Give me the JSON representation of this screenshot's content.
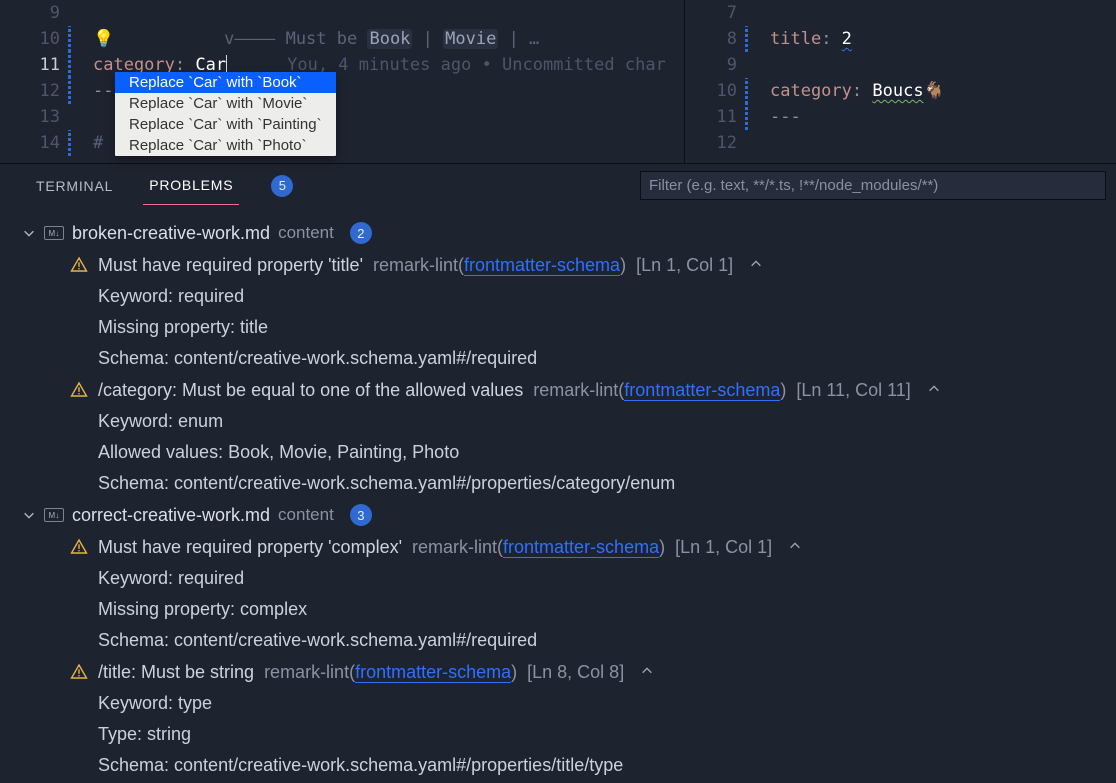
{
  "left_editor": {
    "lines": [
      {
        "num": "9",
        "type": "blank"
      },
      {
        "num": "10",
        "type": "hint",
        "hint_prefix": "v———— Must be ",
        "options": [
          "Book",
          "Movie",
          "…"
        ]
      },
      {
        "num": "11",
        "type": "kv",
        "key": "category",
        "colon": ": ",
        "value": "Car",
        "blame": "You, 4 minutes ago • Uncommitted char"
      },
      {
        "num": "12",
        "type": "dashes",
        "text": "--"
      },
      {
        "num": "13",
        "type": "blank"
      },
      {
        "num": "14",
        "type": "hash",
        "text": "#"
      }
    ]
  },
  "quickfix": [
    "Replace `Car` with `Book`",
    "Replace `Car` with `Movie`",
    "Replace `Car` with `Painting`",
    "Replace `Car` with `Photo`"
  ],
  "right_editor": {
    "lines": [
      {
        "num": "7",
        "type": "blank"
      },
      {
        "num": "8",
        "type": "kv",
        "key": "title",
        "colon": ": ",
        "value": "2",
        "squig": "blue"
      },
      {
        "num": "9",
        "type": "blank"
      },
      {
        "num": "10",
        "type": "kv",
        "key": "category",
        "colon": ": ",
        "value": "Boucs",
        "squig": "green",
        "emoji": "🐐"
      },
      {
        "num": "11",
        "type": "dashes",
        "text": "---"
      },
      {
        "num": "12",
        "type": "blank"
      }
    ]
  },
  "panel": {
    "tabs": {
      "terminal": "TERMINAL",
      "problems": "PROBLEMS"
    },
    "problems_count": "5",
    "filter_placeholder": "Filter (e.g. text, **/*.ts, !**/node_modules/**)"
  },
  "problems": [
    {
      "file": "broken-creative-work.md",
      "dir": "content",
      "count": "2",
      "diags": [
        {
          "msg": "Must have required property 'title'",
          "source": "remark-lint",
          "link": "frontmatter-schema",
          "loc": "[Ln 1, Col 1]",
          "details": [
            "Keyword: required",
            "Missing property: title",
            "Schema: content/creative-work.schema.yaml#/required"
          ]
        },
        {
          "msg": "/category: Must be equal to one of the allowed values",
          "source": "remark-lint",
          "link": "frontmatter-schema",
          "loc": "[Ln 11, Col 11]",
          "details": [
            "Keyword: enum",
            "Allowed values: Book, Movie, Painting, Photo",
            "Schema: content/creative-work.schema.yaml#/properties/category/enum"
          ]
        }
      ]
    },
    {
      "file": "correct-creative-work.md",
      "dir": "content",
      "count": "3",
      "diags": [
        {
          "msg": "Must have required property 'complex'",
          "source": "remark-lint",
          "link": "frontmatter-schema",
          "loc": "[Ln 1, Col 1]",
          "details": [
            "Keyword: required",
            "Missing property: complex",
            "Schema: content/creative-work.schema.yaml#/required"
          ]
        },
        {
          "msg": "/title: Must be string",
          "source": "remark-lint",
          "link": "frontmatter-schema",
          "loc": "[Ln 8, Col 8]",
          "details": [
            "Keyword: type",
            "Type: string",
            "Schema: content/creative-work.schema.yaml#/properties/title/type"
          ]
        }
      ]
    }
  ]
}
